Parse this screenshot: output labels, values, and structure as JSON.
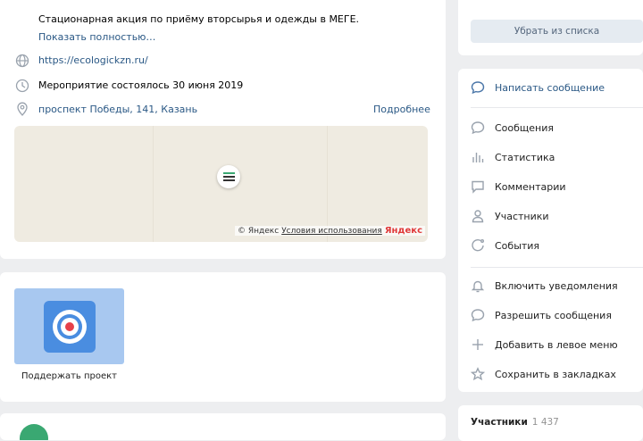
{
  "event": {
    "description": "Стационарная акция по приёму вторсырья и одежды в МЕГЕ.",
    "show_more": "Показать полностью…",
    "website": "https://ecologickzn.ru/",
    "status": "Мероприятие состоялось 30 июня 2019",
    "address": "проспект Победы, 141, Казань",
    "details": "Подробнее"
  },
  "map": {
    "copyright": "© Яндекс",
    "terms": "Условия использования",
    "brand": "Яндекс"
  },
  "support": {
    "label": "Поддержать проект"
  },
  "sidebar": {
    "remove_button": "Убрать из списка",
    "write_message": "Написать сообщение",
    "items": [
      {
        "label": "Сообщения",
        "icon": "chat-bubble-icon"
      },
      {
        "label": "Статистика",
        "icon": "bar-chart-icon"
      },
      {
        "label": "Комментарии",
        "icon": "comment-icon"
      },
      {
        "label": "Участники",
        "icon": "user-icon"
      },
      {
        "label": "События",
        "icon": "calendar-icon"
      }
    ],
    "actions": [
      {
        "label": "Включить уведомления",
        "icon": "bell-icon"
      },
      {
        "label": "Разрешить сообщения",
        "icon": "chat-bubble-icon"
      },
      {
        "label": "Добавить в левое меню",
        "icon": "plus-icon"
      },
      {
        "label": "Сохранить в закладках",
        "icon": "star-icon"
      }
    ],
    "members_label": "Участники",
    "members_count": "1 437"
  },
  "colors": {
    "link": "#2a5885",
    "accent": "#4a76a8",
    "page_bg": "#edeef0",
    "map_bg": "#efebe1",
    "support_tile": "#a8c8f0"
  }
}
